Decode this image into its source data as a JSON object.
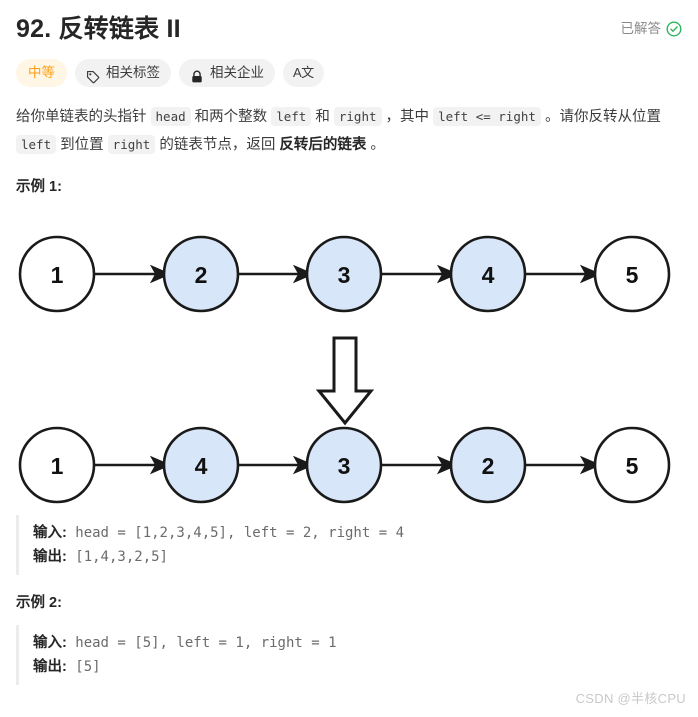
{
  "header": {
    "title": "92. 反转链表 II",
    "status_label": "已解答",
    "status_icon": "check-circle-icon",
    "status_color": "#2db55d"
  },
  "chips": [
    {
      "label": "中等",
      "icon": null,
      "kind": "difficulty",
      "color": "#ffa116"
    },
    {
      "label": "相关标签",
      "icon": "tag-icon",
      "kind": "normal"
    },
    {
      "label": "相关企业",
      "icon": "lock-icon",
      "kind": "normal"
    },
    {
      "label": "A文",
      "icon": null,
      "kind": "language"
    }
  ],
  "description": {
    "seg1": "给你单链表的头指针 ",
    "code1": "head",
    "seg2": " 和两个整数 ",
    "code2": "left",
    "seg3": " 和 ",
    "code3": "right",
    "seg4": " ，其中 ",
    "code4": "left <= right",
    "seg5": " 。请你反转从位置 ",
    "code5": "left",
    "seg6": " 到位置 ",
    "code6": "right",
    "seg7": " 的链表节点，返回 ",
    "bold1": "反转后的链表",
    "seg8": " 。"
  },
  "examples": [
    {
      "heading": "示例 1:",
      "input_label": "输入:",
      "input_value": " head = [1,2,3,4,5], left = 2, right = 4",
      "output_label": "输出:",
      "output_value": " [1,4,3,2,5]"
    },
    {
      "heading": "示例 2:",
      "input_label": "输入:",
      "input_value": " head = [5], left = 1, right = 1",
      "output_label": "输出:",
      "output_value": " [5]"
    }
  ],
  "diagram": {
    "highlight_fill": "#d7e6f8",
    "plain_fill": "#ffffff",
    "stroke": "#1a1a1a",
    "rows": [
      {
        "name": "before",
        "nodes": [
          {
            "value": "1",
            "highlight": false
          },
          {
            "value": "2",
            "highlight": true
          },
          {
            "value": "3",
            "highlight": true
          },
          {
            "value": "4",
            "highlight": true
          },
          {
            "value": "5",
            "highlight": false
          }
        ]
      },
      {
        "name": "after",
        "nodes": [
          {
            "value": "1",
            "highlight": false
          },
          {
            "value": "4",
            "highlight": true
          },
          {
            "value": "3",
            "highlight": true
          },
          {
            "value": "2",
            "highlight": true
          },
          {
            "value": "5",
            "highlight": false
          }
        ]
      }
    ],
    "transform_arrow": "down-block-arrow"
  },
  "watermark": {
    "text": "CSDN @半核CPU"
  }
}
